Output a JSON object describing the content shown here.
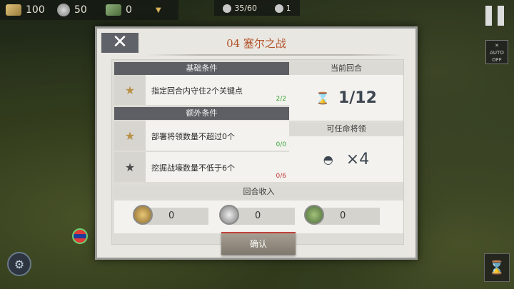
{
  "resources": {
    "gold": "100",
    "iron": "50",
    "food": "0"
  },
  "top_status": {
    "units": "35/60",
    "turn_small": "1"
  },
  "auto_button": {
    "label": "AUTO",
    "state": "OFF"
  },
  "dialog": {
    "title": "04 塞尔之战",
    "basic_header": "基础条件",
    "extra_header": "额外条件",
    "current_turn_header": "当前回合",
    "current_turn_value": "1/12",
    "generals_header": "可任命将领",
    "generals_value": "×4",
    "income_header": "回合收入",
    "conditions": [
      {
        "text": "指定回合内守住2个关键点",
        "count": "2/2",
        "status": "ok",
        "star": "gold"
      },
      {
        "text": "部署将领数量不超过0个",
        "count": "0/0",
        "status": "ok",
        "star": "gold"
      },
      {
        "text": "挖掘战壕数量不低于6个",
        "count": "0/6",
        "status": "bad",
        "star": "grey"
      }
    ],
    "income": {
      "gold": "0",
      "iron": "0",
      "food": "0"
    },
    "confirm_label": "确认"
  }
}
